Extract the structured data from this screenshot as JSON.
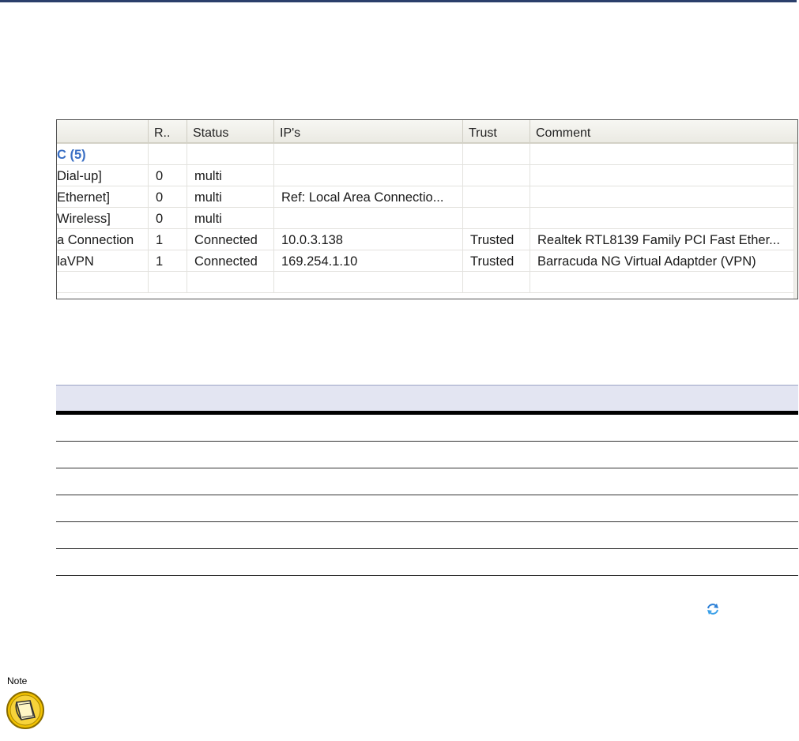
{
  "grid": {
    "columns": [
      "",
      "R..",
      "Status",
      "IP's",
      "Trust",
      "Comment"
    ],
    "rows": [
      {
        "name": "C (5)",
        "r": "",
        "status": "",
        "ips": "",
        "trust": "",
        "comment": "",
        "group": true
      },
      {
        "name": "Dial-up]",
        "r": "0",
        "status": "multi",
        "ips": "",
        "trust": "",
        "comment": ""
      },
      {
        "name": "Ethernet]",
        "r": "0",
        "status": "multi",
        "ips": "Ref: Local Area Connectio...",
        "trust": "",
        "comment": ""
      },
      {
        "name": "Wireless]",
        "r": "0",
        "status": "multi",
        "ips": "",
        "trust": "",
        "comment": ""
      },
      {
        "name": "a Connection",
        "r": "1",
        "status": "Connected",
        "ips": "10.0.3.138",
        "trust": "Trusted",
        "comment": "Realtek RTL8139 Family PCI Fast Ether..."
      },
      {
        "name": "laVPN",
        "r": "1",
        "status": "Connected",
        "ips": "169.254.1.10",
        "trust": "Trusted",
        "comment": "Barracuda NG Virtual Adaptder (VPN)"
      },
      {
        "name": "",
        "r": "",
        "status": "",
        "ips": "",
        "trust": "",
        "comment": ""
      }
    ]
  },
  "doc_table": {
    "row_count": 6
  },
  "note": {
    "label": "Note"
  },
  "colors": {
    "top_rule": "#2b3f6b",
    "group_label": "#3a6fc4",
    "doc_header": "#e3e5f2"
  },
  "icons": {
    "refresh": "refresh-icon",
    "note": "note-icon"
  }
}
